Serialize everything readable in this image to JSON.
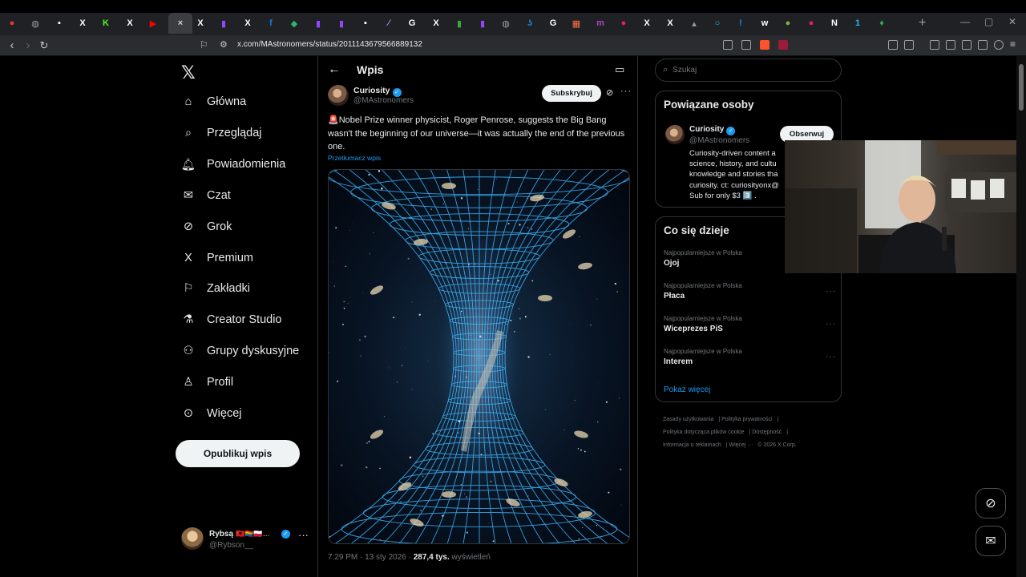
{
  "browser": {
    "url": "x.com/MAstronomers/status/2011143679566889132",
    "tabs": [
      {
        "icon": "rec-icon",
        "color": "#e53935",
        "glyph": "●"
      },
      {
        "icon": "globe-icon",
        "color": "#9aa0a6",
        "glyph": "◍"
      },
      {
        "icon": "app-icon",
        "color": "#ffffff",
        "glyph": "▪"
      },
      {
        "icon": "x-icon",
        "color": "#ffffff",
        "glyph": "X"
      },
      {
        "icon": "kick-icon",
        "color": "#53fc18",
        "glyph": "K"
      },
      {
        "icon": "x-icon",
        "color": "#ffffff",
        "glyph": "X"
      },
      {
        "icon": "youtube-icon",
        "color": "#ff0000",
        "glyph": "▶"
      },
      {
        "icon": "close-tab-icon",
        "color": "#cfcfcf",
        "glyph": "×",
        "active": true
      },
      {
        "icon": "x-icon",
        "color": "#ffffff",
        "glyph": "X"
      },
      {
        "icon": "twitch-icon",
        "color": "#9146ff",
        "glyph": "▮"
      },
      {
        "icon": "x-icon",
        "color": "#ffffff",
        "glyph": "X"
      },
      {
        "icon": "facebook-icon",
        "color": "#1877f2",
        "glyph": "f"
      },
      {
        "icon": "chat-icon",
        "color": "#2bb673",
        "glyph": "◆"
      },
      {
        "icon": "twitch-icon",
        "color": "#9146ff",
        "glyph": "▮"
      },
      {
        "icon": "twitch-icon",
        "color": "#9146ff",
        "glyph": "▮"
      },
      {
        "icon": "app-icon",
        "color": "#ffffff",
        "glyph": "▪"
      },
      {
        "icon": "feather-icon",
        "color": "#b388ff",
        "glyph": "⁄"
      },
      {
        "icon": "google-icon",
        "color": "#ffffff",
        "glyph": "G"
      },
      {
        "icon": "x-icon",
        "color": "#ffffff",
        "glyph": "X"
      },
      {
        "icon": "green-app-icon",
        "color": "#43a047",
        "glyph": "▮"
      },
      {
        "icon": "twitch-icon",
        "color": "#9146ff",
        "glyph": "▮"
      },
      {
        "icon": "globe-icon",
        "color": "#9aa0a6",
        "glyph": "◍"
      },
      {
        "icon": "shazam-icon",
        "color": "#1e88e5",
        "glyph": "ʖ"
      },
      {
        "icon": "google-icon",
        "color": "#ffffff",
        "glyph": "G"
      },
      {
        "icon": "grid-icon",
        "color": "#ff7043",
        "glyph": "▦"
      },
      {
        "icon": "m-icon",
        "color": "#ab47bc",
        "glyph": "m"
      },
      {
        "icon": "app-icon",
        "color": "#e91e63",
        "glyph": "●"
      },
      {
        "icon": "x-icon",
        "color": "#ffffff",
        "glyph": "X"
      },
      {
        "icon": "x-icon",
        "color": "#ffffff",
        "glyph": "X"
      },
      {
        "icon": "app-icon",
        "color": "#9e9e9e",
        "glyph": "▴"
      },
      {
        "icon": "ring-icon",
        "color": "#26c6da",
        "glyph": "○"
      },
      {
        "icon": "info-icon",
        "color": "#1e88e5",
        "glyph": "!"
      },
      {
        "icon": "wz-icon",
        "color": "#ffffff",
        "glyph": "w"
      },
      {
        "icon": "app-icon",
        "color": "#7cb342",
        "glyph": "●"
      },
      {
        "icon": "app-icon",
        "color": "#e91e63",
        "glyph": "●"
      },
      {
        "icon": "notion-icon",
        "color": "#ffffff",
        "glyph": "N"
      },
      {
        "icon": "app-icon",
        "color": "#29b6f6",
        "glyph": "1"
      },
      {
        "icon": "maps-icon",
        "color": "#34a853",
        "glyph": "♦"
      }
    ]
  },
  "sidebar": {
    "items": [
      {
        "label": "Główna",
        "icon": "home-icon"
      },
      {
        "label": "Przeglądaj",
        "icon": "search-icon"
      },
      {
        "label": "Powiadomienia",
        "icon": "bell-icon"
      },
      {
        "label": "Czat",
        "icon": "mail-icon"
      },
      {
        "label": "Grok",
        "icon": "grok-icon"
      },
      {
        "label": "Premium",
        "icon": "x-premium-icon"
      },
      {
        "label": "Zakładki",
        "icon": "bookmark-icon"
      },
      {
        "label": "Creator Studio",
        "icon": "flask-icon"
      },
      {
        "label": "Grupy dyskusyjne",
        "icon": "people-icon"
      },
      {
        "label": "Profil",
        "icon": "person-icon"
      },
      {
        "label": "Więcej",
        "icon": "more-circle-icon"
      }
    ],
    "publish_label": "Opublikuj wpis",
    "user": {
      "name": "Rybsą",
      "flags": "🇦🇱🏳️‍🌈🇵🇱…",
      "handle": "@Rybson__"
    }
  },
  "post": {
    "header_title": "Wpis",
    "author_name": "Curiosity",
    "author_handle": "@MAstronomers",
    "subscribe_label": "Subskrybuj",
    "text": "🚨Nobel Prize winner physicist, Roger Penrose, suggests the Big Bang wasn't the beginning of our universe—it was actually the end of the previous one.",
    "translate_label": "Przetłumacz wpis",
    "time": "7:29 PM · 13 sty 2026 · ",
    "views": "287,4 tys.",
    "views_label": " wyświetleń"
  },
  "right": {
    "search_placeholder": "Szukaj",
    "related": {
      "title": "Powiązane osoby",
      "name": "Curiosity",
      "handle": "@MAstronomers",
      "follow_label": "Obserwuj",
      "bio": "Curiosity-driven content a\nscience, history, and cultu\nknowledge and stories tha\ncuriosity. ct: curiosityonx@\nSub for only $3 3️⃣ ."
    },
    "trends": {
      "title": "Co się dzieje",
      "items": [
        {
          "label": "Najpopularniejsze w Polska",
          "name": "Ojoj"
        },
        {
          "label": "Najpopularniejsze w Polska",
          "name": "Płaca"
        },
        {
          "label": "Najpopularniejsze w Polska",
          "name": "Wiceprezes PiS"
        },
        {
          "label": "Najpopularniejsze w Polska",
          "name": "Interem"
        }
      ],
      "show_more": "Pokaż więcej"
    },
    "footer": {
      "terms": "Zasady użytkowania",
      "privacy": "Polityka prywatności",
      "cookies": "Polityka dotycząca plików cookie",
      "accessibility": "Dostępność",
      "ads": "Informacja o reklamach",
      "more": "Więcej ···",
      "copyright": "© 2026 X Corp."
    }
  },
  "colors": {
    "accent": "#1d9bf0",
    "background": "#000000",
    "border": "#2f3336",
    "muted": "#71767b"
  }
}
